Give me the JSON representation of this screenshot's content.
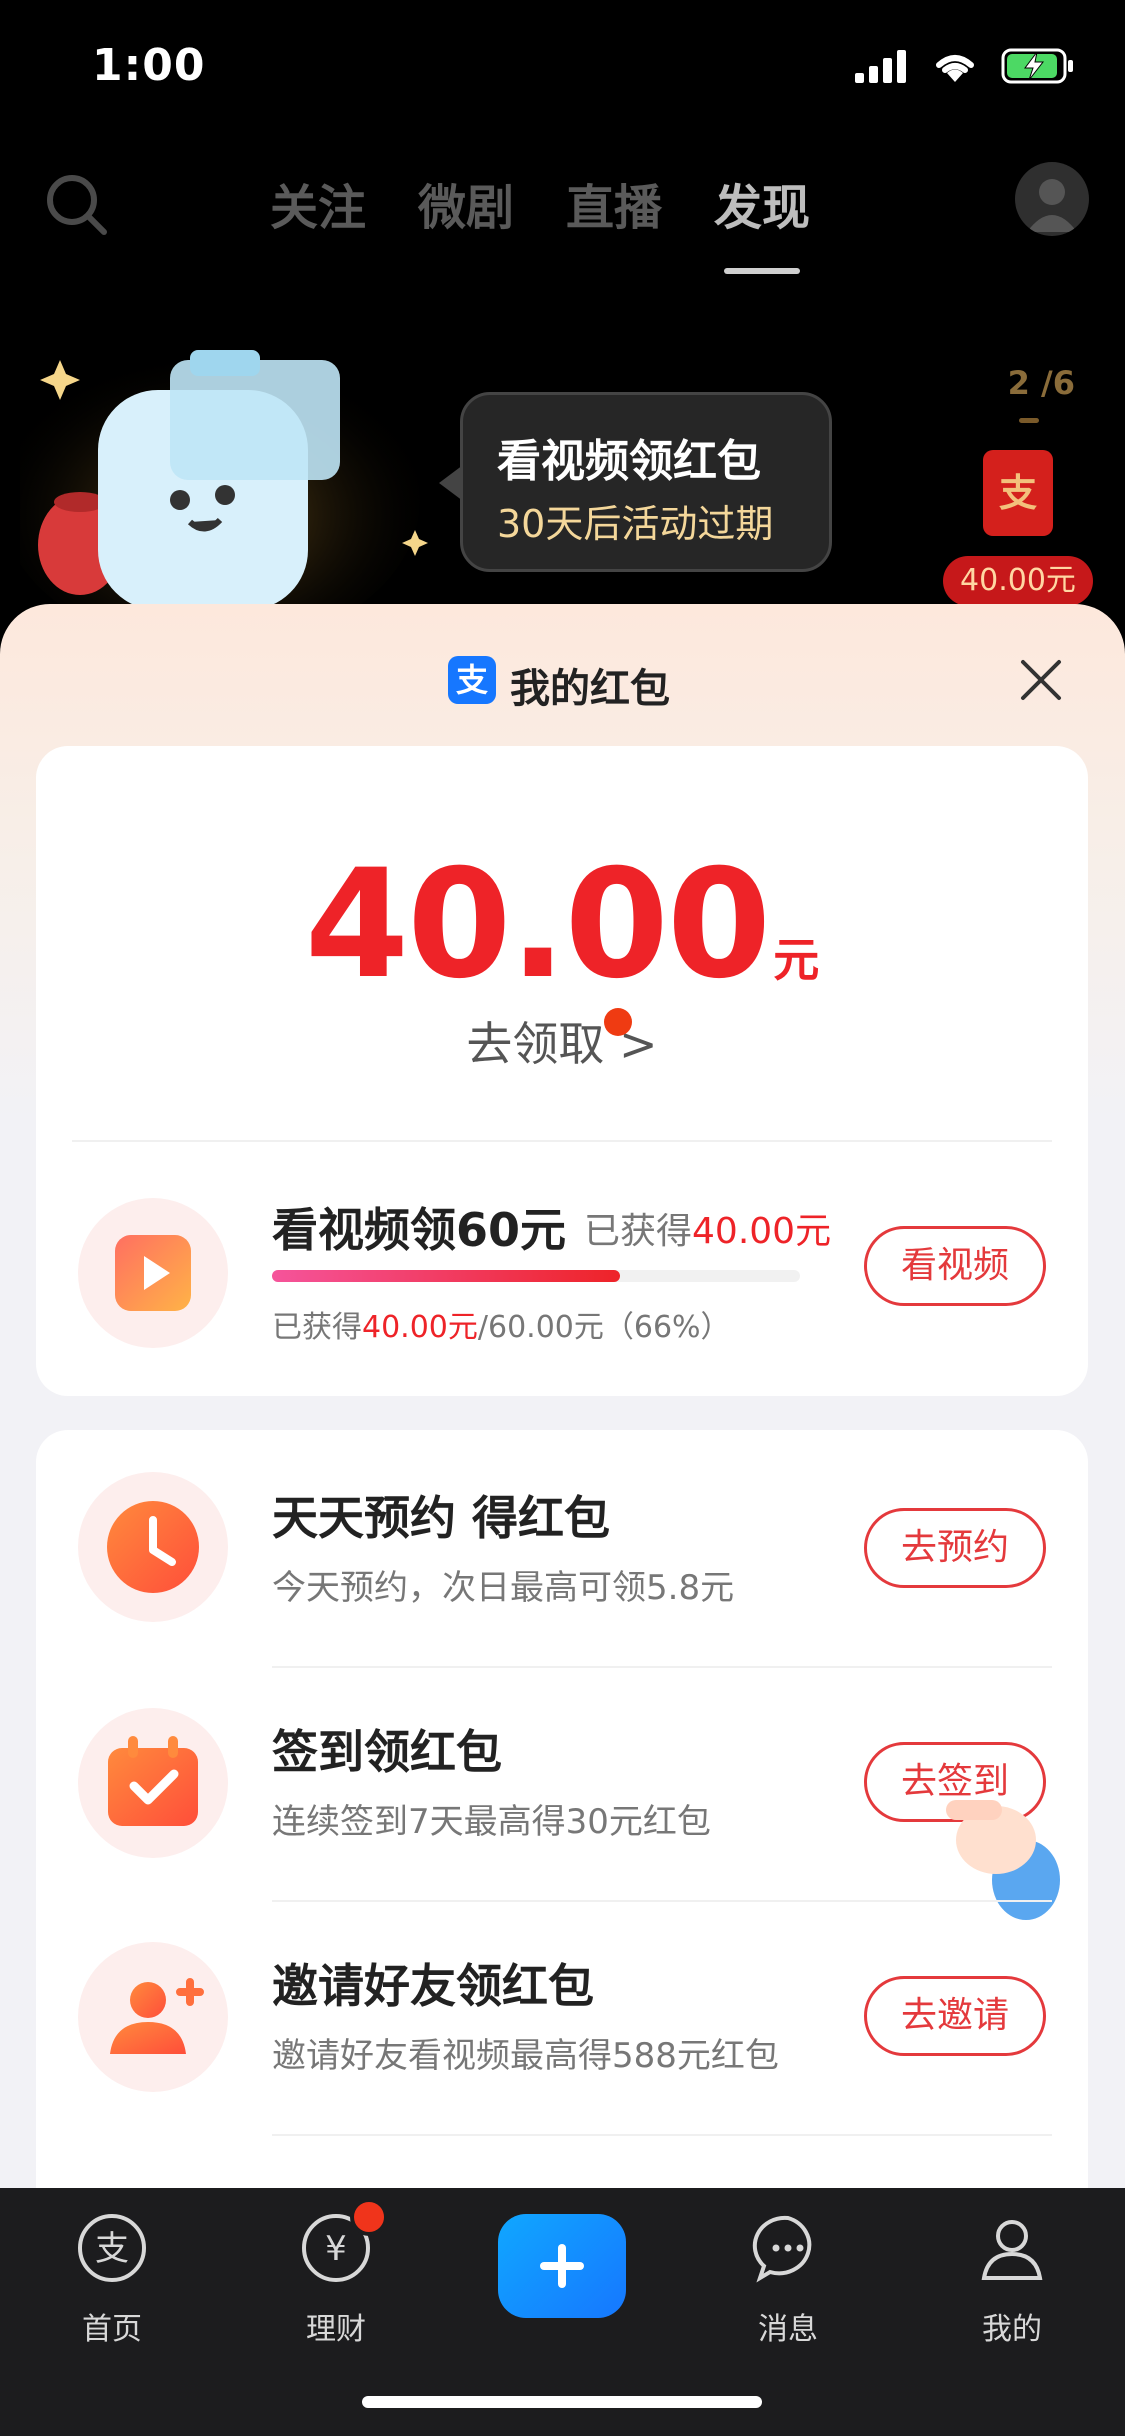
{
  "status_bar": {
    "time": "1:00",
    "icons": [
      "signal-icon",
      "wifi-icon",
      "battery-charging-icon"
    ]
  },
  "top_nav": {
    "tabs": [
      {
        "label": "关注",
        "active": false
      },
      {
        "label": "微剧",
        "active": false
      },
      {
        "label": "直播",
        "active": false
      },
      {
        "label": "发现",
        "active": true
      }
    ]
  },
  "promo": {
    "bubble_title": "看视频领红包",
    "bubble_subtitle": "30天后活动过期",
    "page_indicator": "2 /6",
    "mini_envelope_glyph": "支",
    "mini_amount": "40.00元"
  },
  "sheet": {
    "logo_glyph": "支",
    "title": "我的红包",
    "balance": {
      "amount": "40.00",
      "unit": "元",
      "claim_label": "去领取 >"
    },
    "video_task": {
      "title": "看视频领60元",
      "earned_prefix": "已获得",
      "earned_value": "40.00元",
      "progress_prefix": "已获得",
      "progress_value": "40.00元",
      "progress_suffix": "/60.00元（66%）",
      "progress_fraction": 0.66,
      "button": "看视频"
    },
    "tasks": [
      {
        "title": "天天预约 得红包",
        "subtitle": "今天预约，次日最高可领5.8元",
        "button": "去预约"
      },
      {
        "title": "签到领红包",
        "subtitle": "连续签到7天最高得30元红包",
        "button": "去签到"
      },
      {
        "title": "邀请好友领红包",
        "subtitle": "邀请好友看视频最高得588元红包",
        "button": "去邀请"
      }
    ]
  },
  "bottom_nav": {
    "items": [
      {
        "label": "首页",
        "icon": "alipay-home-icon"
      },
      {
        "label": "理财",
        "icon": "yuan-icon"
      },
      {
        "label": "",
        "icon": "plus-icon"
      },
      {
        "label": "消息",
        "icon": "chat-bubble-icon"
      },
      {
        "label": "我的",
        "icon": "person-icon"
      }
    ]
  },
  "colors": {
    "accent_red": "#ee2328",
    "alipay_blue": "#1677ff",
    "progress_pink": "#f5549b"
  }
}
